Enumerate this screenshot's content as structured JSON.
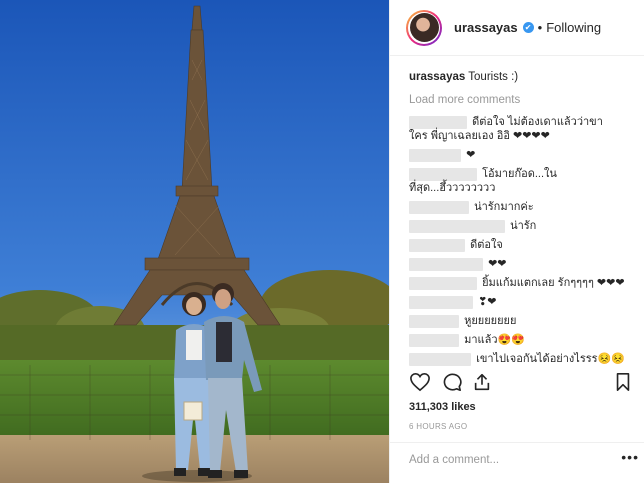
{
  "header": {
    "username": "urassayas",
    "verified_mark": "✔",
    "follow_label": "Following",
    "separator": "•"
  },
  "caption": {
    "username": "urassayas",
    "text": "Tourists :)"
  },
  "load_more_label": "Load more comments",
  "comments": [
    {
      "text": "ดีต่อใจ ไม่ต้องเดาแล้วว่าขาใคร พี่ญาเฉลยเอง อิอิ ❤❤❤❤"
    },
    {
      "text": "❤"
    },
    {
      "text": "โอ้มายก๊อด...ใน ที่สุด...ฮึ้วววววววว"
    },
    {
      "text": "น่ารักมากค่ะ"
    },
    {
      "text": "น่ารัก"
    },
    {
      "text": "ดีต่อใจ"
    },
    {
      "text": "❤❤"
    },
    {
      "text": "ยิ้มแก้มแตกเลย รักๆๆๆๆ ❤❤❤"
    },
    {
      "text": "❣❤"
    },
    {
      "text": "หูยยยยยยย"
    },
    {
      "text": "มาแล้ว😍😍"
    },
    {
      "text": "เขาไปเจอกันได้อย่างไรรร😣😣"
    }
  ],
  "likes": "311,303 likes",
  "time": "6 HOURS AGO",
  "add_comment_placeholder": "Add a comment...",
  "more_label": "•••",
  "icons": [
    "heart-icon",
    "comment-icon",
    "share-icon",
    "bookmark-icon"
  ]
}
